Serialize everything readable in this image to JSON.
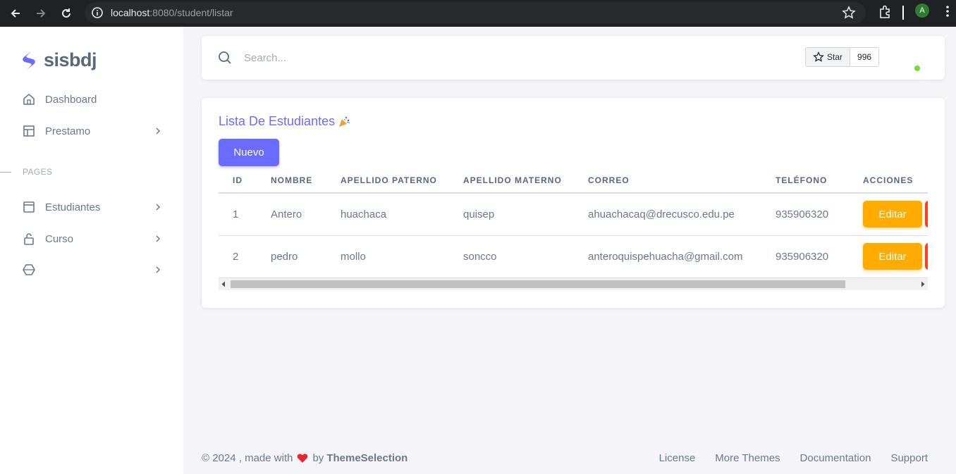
{
  "browser": {
    "url_host": "localhost",
    "url_path": ":8080/student/listar",
    "profile_initial": "A"
  },
  "sidebar": {
    "brand": "sisbdj",
    "items": [
      {
        "label": "Dashboard",
        "icon": "home-icon"
      },
      {
        "label": "Prestamo",
        "icon": "layout-icon"
      }
    ],
    "section_title": "PAGES",
    "pages": [
      {
        "label": "Estudiantes",
        "icon": "window-icon"
      },
      {
        "label": "Curso",
        "icon": "lock-icon"
      },
      {
        "label": "",
        "icon": "cube-icon"
      }
    ]
  },
  "topbar": {
    "search_placeholder": "Search...",
    "star_label": "Star",
    "star_count": "996"
  },
  "card": {
    "title": "Lista De Estudiantes",
    "new_button": "Nuevo",
    "columns": [
      "ID",
      "NOMBRE",
      "APELLIDO PATERNO",
      "APELLIDO MATERNO",
      "CORREO",
      "TELÉFONO",
      "ACCIONES"
    ],
    "rows": [
      {
        "id": "1",
        "nombre": "Antero",
        "paterno": "huachaca",
        "materno": "quisep",
        "correo": "ahuachacaq@drecusco.edu.pe",
        "telefono": "935906320",
        "edit": "Editar"
      },
      {
        "id": "2",
        "nombre": "pedro",
        "paterno": "mollo",
        "materno": "soncco",
        "correo": "anteroquispehuacha@gmail.com",
        "telefono": "935906320",
        "edit": "Editar"
      }
    ]
  },
  "footer": {
    "copyright": "© 2024 , made with",
    "by": "by",
    "brand": "ThemeSelection",
    "links": [
      "License",
      "More Themes",
      "Documentation",
      "Support"
    ]
  },
  "colors": {
    "primary": "#696cff",
    "warning": "#ffab00",
    "danger": "#ff3e1d",
    "online": "#71dd37"
  }
}
